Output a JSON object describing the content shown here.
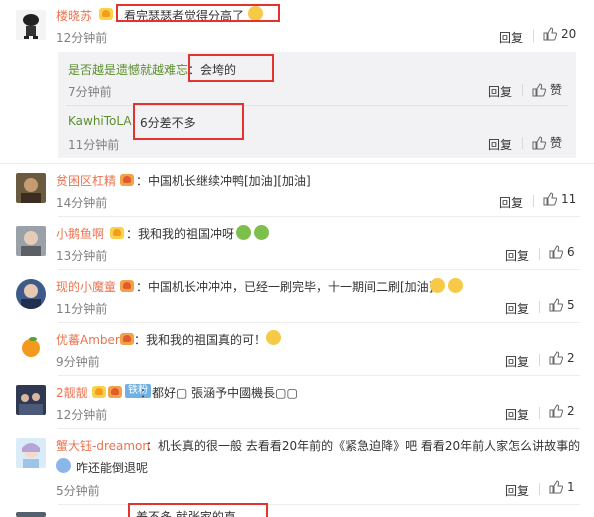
{
  "comments": [
    {
      "user": "楼晓苏",
      "text": "看完瑟瑟者觉得分高了",
      "time": "12分钟前",
      "reply": "回复",
      "likes": "20",
      "replies": [
        {
          "user": "是否越是遗憾就越难忘",
          "text": "会垮的",
          "time": "7分钟前",
          "reply": "回复",
          "likes": "赞"
        },
        {
          "user": "KawhiToLA",
          "text": "6分差不多",
          "time": "11分钟前",
          "reply": "回复",
          "likes": "赞"
        }
      ]
    },
    {
      "user": "贫困区杠精",
      "text": "：中国机长继续冲鸭[加油][加油]",
      "time": "14分钟前",
      "reply": "回复",
      "likes": "11"
    },
    {
      "user": "小鹅鱼啊",
      "text": "：我和我的祖国冲呀",
      "time": "13分钟前",
      "reply": "回复",
      "likes": "6"
    },
    {
      "user": "现的小魔童",
      "text": "：中国机长冲冲冲，已经一刷完毕，十一期间二刷[加油]",
      "time": "11分钟前",
      "reply": "回复",
      "likes": "5"
    },
    {
      "user": "优蕃Amber",
      "text": "：我和我的祖国真的可！",
      "time": "9分钟前",
      "reply": "回复",
      "likes": "2"
    },
    {
      "user": "2靓靓",
      "fan_tag": "铁粉",
      "text": "：都好▢  張涵予中國機長▢▢",
      "time": "12分钟前",
      "reply": "回复",
      "likes": "2"
    },
    {
      "user": "蟹大钰-dreamon",
      "text": "：机长真的很一般 去看看20年前的《紧急迫降》吧 看看20年前人家怎么讲故事的",
      "text2": "咋还能倒退呢",
      "time": "5分钟前",
      "reply": "回复",
      "likes": "1"
    }
  ],
  "partial_text": "差不多  就张家的直",
  "colors": {
    "name": "#eb7350",
    "reply_name": "#5b8f2d",
    "highlight": "#e2332f",
    "fan_tag": "#6fb1e3"
  }
}
